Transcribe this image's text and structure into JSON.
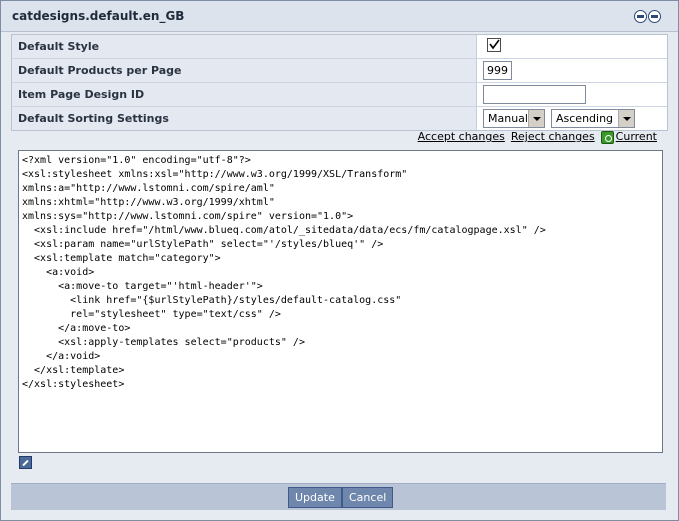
{
  "window": {
    "title": "catdesigns.default.en_GB"
  },
  "props": {
    "default_style_label": "Default Style",
    "default_style_checked": true,
    "products_per_page_label": "Default Products per Page",
    "products_per_page_value": "999",
    "item_page_label": "Item Page Design ID",
    "item_page_value": "",
    "sorting_label": "Default Sorting Settings",
    "sort_field": "Manual",
    "sort_order": "Ascending"
  },
  "actions": {
    "accept": "Accept changes",
    "reject": "Reject changes",
    "current": "Current"
  },
  "code_lines": [
    "<?xml version=\"1.0\" encoding=\"utf-8\"?>",
    "<xsl:stylesheet xmlns:xsl=\"http://www.w3.org/1999/XSL/Transform\"",
    "xmlns:a=\"http://www.lstomni.com/spire/aml\"",
    "xmlns:xhtml=\"http://www.w3.org/1999/xhtml\"",
    "xmlns:sys=\"http://www.lstomni.com/spire\" version=\"1.0\">",
    "  <xsl:include href=\"/html/www.blueq.com/atol/_sitedata/data/ecs/fm/catalogpage.xsl\" />",
    "  <xsl:param name=\"urlStylePath\" select=\"'/styles/blueq'\" />",
    "  <xsl:template match=\"category\">",
    "    <a:void>",
    "      <a:move-to target=\"'html-header'\">",
    "        <link href=\"{$urlStylePath}/styles/default-catalog.css\"",
    "        rel=\"stylesheet\" type=\"text/css\" />",
    "      </a:move-to>",
    "      <xsl:apply-templates select=\"products\" />",
    "    </a:void>",
    "  </xsl:template>",
    "</xsl:stylesheet>"
  ],
  "footer": {
    "update": "Update",
    "cancel": "Cancel"
  }
}
